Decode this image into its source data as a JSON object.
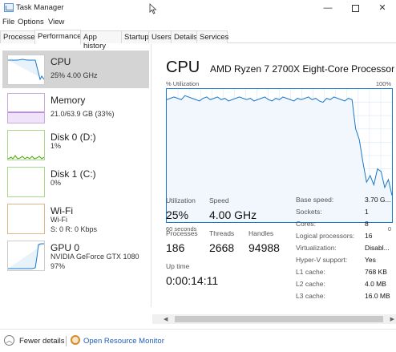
{
  "window": {
    "title": "Task Manager"
  },
  "menu": [
    "File",
    "Options",
    "View"
  ],
  "tabs": [
    "Processes",
    "Performance",
    "App history",
    "Startup",
    "Users",
    "Details",
    "Services"
  ],
  "sidebar": {
    "items": [
      {
        "title": "CPU",
        "lines": [
          "25% 4.00 GHz"
        ],
        "color": "#1a77c9"
      },
      {
        "title": "Memory",
        "lines": [
          "21.0/63.9 GB (33%)"
        ],
        "color": "#8b2fc9"
      },
      {
        "title": "Disk 0 (D:)",
        "lines": [
          "1%"
        ],
        "color": "#4da60c"
      },
      {
        "title": "Disk 1 (C:)",
        "lines": [
          "0%"
        ],
        "color": "#4da60c"
      },
      {
        "title": "Wi-Fi",
        "lines": [
          "Wi-Fi",
          "S: 0 R: 0 Kbps"
        ],
        "color": "#a74f01"
      },
      {
        "title": "GPU 0",
        "lines": [
          "NVIDIA GeForce GTX 1080",
          "97%"
        ],
        "color": "#1a77c9"
      }
    ]
  },
  "cpu": {
    "title": "CPU",
    "model": "AMD Ryzen 7 2700X Eight-Core Processor",
    "graph_label": "% Utilization",
    "graph_max": "100%",
    "graph_time": "60 seconds",
    "graph_min": "0",
    "utilization_label": "Utilization",
    "utilization_value": "25%",
    "speed_label": "Speed",
    "speed_value": "4.00 GHz",
    "processes_label": "Processes",
    "processes_value": "186",
    "threads_label": "Threads",
    "threads_value": "2668",
    "handles_label": "Handles",
    "handles_value": "94988",
    "uptime_label": "Up time",
    "uptime_value": "0:00:14:11",
    "specs": [
      {
        "label": "Base speed:",
        "value": "3.70 G..."
      },
      {
        "label": "Sockets:",
        "value": "1"
      },
      {
        "label": "Cores:",
        "value": "8"
      },
      {
        "label": "Logical processors:",
        "value": "16"
      },
      {
        "label": "Virtualization:",
        "value": "Disabl..."
      },
      {
        "label": "Hyper-V support:",
        "value": "Yes"
      },
      {
        "label": "L1 cache:",
        "value": "768 KB"
      },
      {
        "label": "L2 cache:",
        "value": "4.0 MB"
      },
      {
        "label": "L3 cache:",
        "value": "16.0 MB"
      }
    ],
    "history": [
      92,
      93,
      94,
      93,
      92,
      95,
      94,
      93,
      92,
      91,
      93,
      94,
      92,
      93,
      94,
      92,
      93,
      91,
      92,
      93,
      94,
      93,
      92,
      93,
      91,
      92,
      93,
      94,
      92,
      91,
      93,
      92,
      94,
      93,
      92,
      91,
      93,
      92,
      93,
      94,
      92,
      93,
      91,
      90,
      93,
      92,
      94,
      93,
      92,
      91,
      93,
      92,
      70,
      62,
      45,
      30,
      35,
      28,
      40,
      38,
      26,
      32,
      20
    ]
  },
  "footer": {
    "fewer_details": "Fewer details",
    "resource_monitor": "Open Resource Monitor"
  }
}
